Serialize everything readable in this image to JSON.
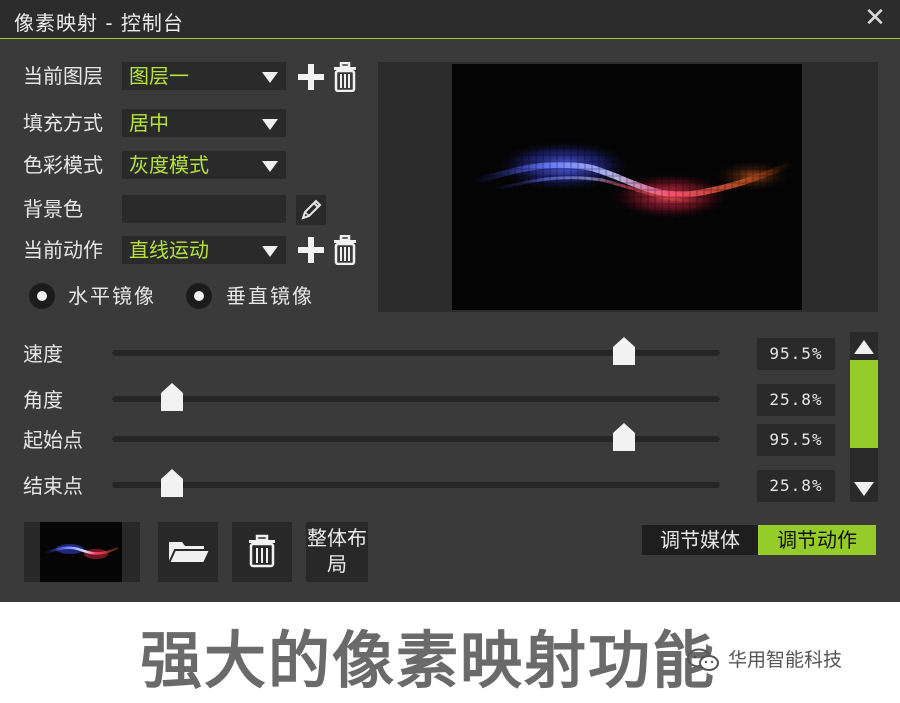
{
  "window": {
    "title": "像素映射 - 控制台",
    "close_glyph": "✕",
    "accent_color": "#96cc2a",
    "value_text_color": "#b5e33a"
  },
  "settings": {
    "layer": {
      "label": "当前图层",
      "value": "图层一"
    },
    "fill": {
      "label": "填充方式",
      "value": "居中"
    },
    "color_mode": {
      "label": "色彩模式",
      "value": "灰度模式"
    },
    "background": {
      "label": "背景色",
      "value": ""
    },
    "action": {
      "label": "当前动作",
      "value": "直线运动"
    }
  },
  "mirror": {
    "horizontal": "水平镜像",
    "vertical": "垂直镜像"
  },
  "sliders": [
    {
      "label": "速度",
      "value_text": "95.5%",
      "level": 0.955
    },
    {
      "label": "角度",
      "value_text": "25.8%",
      "level": 0.258
    },
    {
      "label": "起始点",
      "value_text": "95.5%",
      "level": 0.955
    },
    {
      "label": "结束点",
      "value_text": "25.8%",
      "level": 0.258
    }
  ],
  "bottom": {
    "layout_button": "整体布局",
    "tab_media": "调节媒体",
    "tab_action": "调节动作",
    "active_tab": "调节动作"
  },
  "icons": [
    "close-icon",
    "plus-icon",
    "trash-icon",
    "pencil-icon",
    "folder-icon",
    "chevron-up-icon",
    "chevron-down-icon",
    "wechat-icon"
  ],
  "caption": "强大的像素映射功能",
  "watermark": "华用智能科技"
}
